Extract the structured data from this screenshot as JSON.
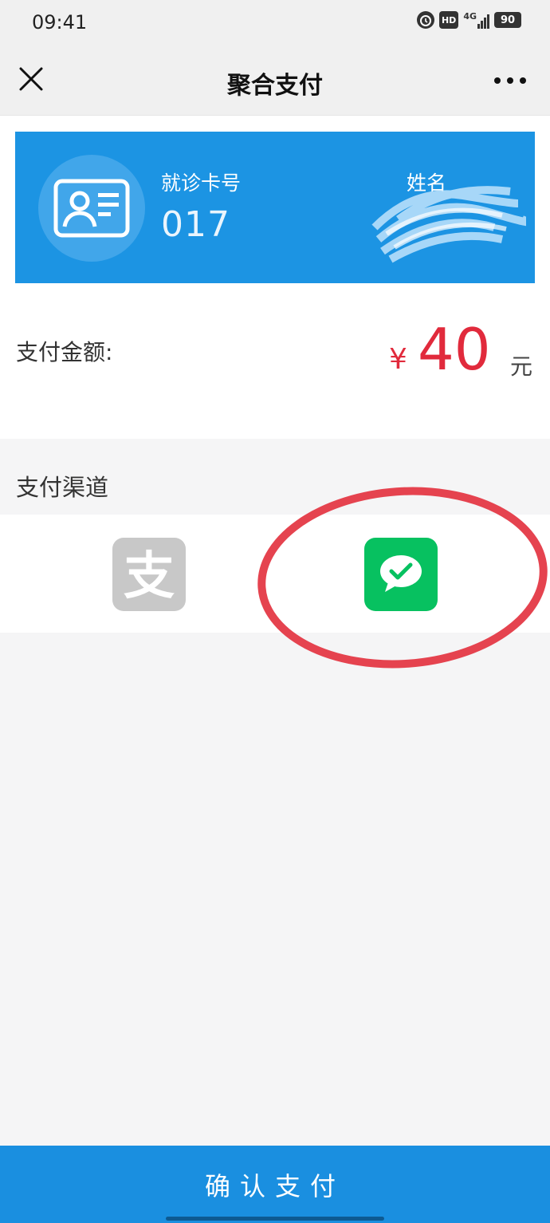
{
  "status_bar": {
    "time": "09:41",
    "icons": [
      "alarm-icon",
      "hd-icon",
      "signal-4g-icon",
      "battery-icon"
    ],
    "hd_label": "HD",
    "network_label": "4G",
    "battery_level": "90"
  },
  "nav": {
    "title": "聚合支付",
    "close_icon": "close-icon",
    "more_icon": "more-icon"
  },
  "card": {
    "card_no_label": "就诊卡号",
    "card_no_value": "017",
    "name_label": "姓名",
    "bg_color": "#1c94e3"
  },
  "payment": {
    "amount_label": "支付金额:",
    "currency_symbol": "¥",
    "amount": "40",
    "unit": "元",
    "amount_color": "#e12a3c"
  },
  "channels": {
    "title": "支付渠道",
    "items": [
      {
        "name": "alipay",
        "icon": "alipay-icon",
        "glyph": "支",
        "color": "#c8c8c8"
      },
      {
        "name": "wechat-pay",
        "icon": "wechat-pay-icon",
        "color": "#07c160",
        "selected": true
      }
    ]
  },
  "footer": {
    "confirm_label": "确认支付",
    "button_color": "#1a8fe0"
  }
}
